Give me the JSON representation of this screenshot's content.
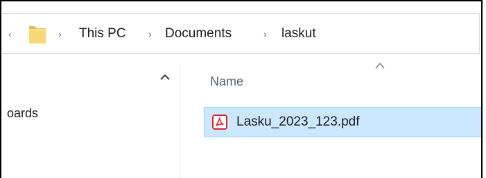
{
  "breadcrumb": {
    "items": [
      "This PC",
      "Documents",
      "laskut"
    ],
    "separator": "›"
  },
  "nav_pane": {
    "visible_item": "oards"
  },
  "file_list": {
    "column_header": "Name",
    "files": [
      {
        "name": "Lasku_2023_123.pdf",
        "selected": true,
        "icon": "pdf-icon"
      }
    ]
  },
  "colors": {
    "selection_bg": "#cce8ff",
    "selection_border": "#99d1ff",
    "pdf_red": "#d9252a",
    "folder_yellow": "#f8d775"
  }
}
